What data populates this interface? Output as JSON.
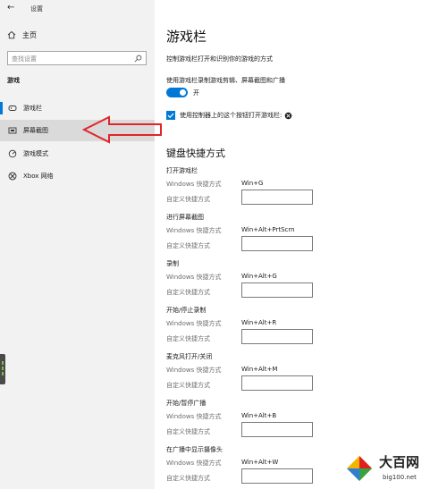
{
  "window": {
    "back_glyph": "←",
    "title": "设置"
  },
  "sidebar": {
    "home_label": "主页",
    "search_placeholder": "查找设置",
    "section_label": "游戏",
    "items": [
      {
        "label": "游戏栏",
        "icon": "game-bar-icon",
        "active": true
      },
      {
        "label": "屏幕截图",
        "icon": "screenshot-icon",
        "selected": true
      },
      {
        "label": "游戏模式",
        "icon": "game-mode-icon"
      },
      {
        "label": "Xbox 网络",
        "icon": "xbox-icon"
      }
    ]
  },
  "main": {
    "title": "游戏栏",
    "description": "控制游戏栏打开和识别你的游戏的方式",
    "record_label": "使用游戏栏录制游戏剪辑、屏幕截图和广播",
    "toggle_state": "开",
    "toggle_on": true,
    "controller_checkbox_label": "使用控制器上的这个按钮打开游戏栏:",
    "controller_checked": true,
    "keyboard_title": "键盘快捷方式",
    "shortcuts": [
      {
        "name": "打开游戏栏",
        "windows_label": "Windows 快捷方式",
        "windows_value": "Win+G",
        "custom_label": "自定义快捷方式",
        "custom_value": ""
      },
      {
        "name": "进行屏幕截图",
        "windows_label": "Windows 快捷方式",
        "windows_value": "Win+Alt+PrtScrn",
        "custom_label": "自定义快捷方式",
        "custom_value": ""
      },
      {
        "name": "录制",
        "windows_label": "Windows 快捷方式",
        "windows_value": "Win+Alt+G",
        "custom_label": "自定义快捷方式",
        "custom_value": ""
      },
      {
        "name": "开始/停止录制",
        "windows_label": "Windows 快捷方式",
        "windows_value": "Win+Alt+R",
        "custom_label": "自定义快捷方式",
        "custom_value": ""
      },
      {
        "name": "麦克风打开/关闭",
        "windows_label": "Windows 快捷方式",
        "windows_value": "Win+Alt+M",
        "custom_label": "自定义快捷方式",
        "custom_value": ""
      },
      {
        "name": "开始/暂停广播",
        "windows_label": "Windows 快捷方式",
        "windows_value": "Win+Alt+B",
        "custom_label": "自定义快捷方式",
        "custom_value": ""
      },
      {
        "name": "在广播中显示摄像头",
        "windows_label": "Windows 快捷方式",
        "windows_value": "Win+Alt+W",
        "custom_label": "自定义快捷方式",
        "custom_value": ""
      }
    ]
  },
  "watermark": {
    "name": "大百网",
    "url": "big100.net"
  },
  "colors": {
    "accent": "#0078d7",
    "sidebar_bg": "#f2f2f2",
    "selected_bg": "#dadada",
    "arrow": "#e0262b"
  }
}
